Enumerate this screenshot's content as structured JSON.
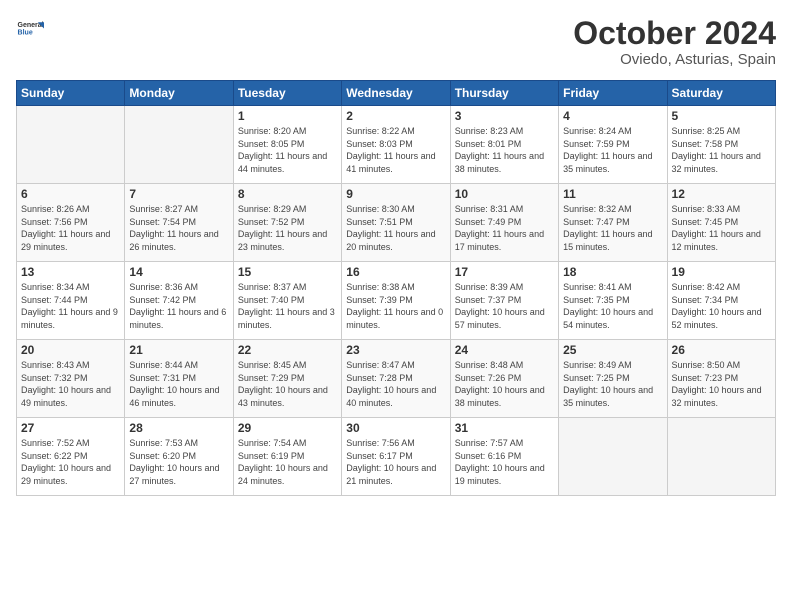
{
  "header": {
    "logo_line1": "General",
    "logo_line2": "Blue",
    "month_title": "October 2024",
    "location": "Oviedo, Asturias, Spain"
  },
  "weekdays": [
    "Sunday",
    "Monday",
    "Tuesday",
    "Wednesday",
    "Thursday",
    "Friday",
    "Saturday"
  ],
  "weeks": [
    [
      {
        "day": "",
        "empty": true
      },
      {
        "day": "",
        "empty": true
      },
      {
        "day": "1",
        "sunrise": "8:20 AM",
        "sunset": "8:05 PM",
        "daylight": "11 hours and 44 minutes."
      },
      {
        "day": "2",
        "sunrise": "8:22 AM",
        "sunset": "8:03 PM",
        "daylight": "11 hours and 41 minutes."
      },
      {
        "day": "3",
        "sunrise": "8:23 AM",
        "sunset": "8:01 PM",
        "daylight": "11 hours and 38 minutes."
      },
      {
        "day": "4",
        "sunrise": "8:24 AM",
        "sunset": "7:59 PM",
        "daylight": "11 hours and 35 minutes."
      },
      {
        "day": "5",
        "sunrise": "8:25 AM",
        "sunset": "7:58 PM",
        "daylight": "11 hours and 32 minutes."
      }
    ],
    [
      {
        "day": "6",
        "sunrise": "8:26 AM",
        "sunset": "7:56 PM",
        "daylight": "11 hours and 29 minutes."
      },
      {
        "day": "7",
        "sunrise": "8:27 AM",
        "sunset": "7:54 PM",
        "daylight": "11 hours and 26 minutes."
      },
      {
        "day": "8",
        "sunrise": "8:29 AM",
        "sunset": "7:52 PM",
        "daylight": "11 hours and 23 minutes."
      },
      {
        "day": "9",
        "sunrise": "8:30 AM",
        "sunset": "7:51 PM",
        "daylight": "11 hours and 20 minutes."
      },
      {
        "day": "10",
        "sunrise": "8:31 AM",
        "sunset": "7:49 PM",
        "daylight": "11 hours and 17 minutes."
      },
      {
        "day": "11",
        "sunrise": "8:32 AM",
        "sunset": "7:47 PM",
        "daylight": "11 hours and 15 minutes."
      },
      {
        "day": "12",
        "sunrise": "8:33 AM",
        "sunset": "7:45 PM",
        "daylight": "11 hours and 12 minutes."
      }
    ],
    [
      {
        "day": "13",
        "sunrise": "8:34 AM",
        "sunset": "7:44 PM",
        "daylight": "11 hours and 9 minutes."
      },
      {
        "day": "14",
        "sunrise": "8:36 AM",
        "sunset": "7:42 PM",
        "daylight": "11 hours and 6 minutes."
      },
      {
        "day": "15",
        "sunrise": "8:37 AM",
        "sunset": "7:40 PM",
        "daylight": "11 hours and 3 minutes."
      },
      {
        "day": "16",
        "sunrise": "8:38 AM",
        "sunset": "7:39 PM",
        "daylight": "11 hours and 0 minutes."
      },
      {
        "day": "17",
        "sunrise": "8:39 AM",
        "sunset": "7:37 PM",
        "daylight": "10 hours and 57 minutes."
      },
      {
        "day": "18",
        "sunrise": "8:41 AM",
        "sunset": "7:35 PM",
        "daylight": "10 hours and 54 minutes."
      },
      {
        "day": "19",
        "sunrise": "8:42 AM",
        "sunset": "7:34 PM",
        "daylight": "10 hours and 52 minutes."
      }
    ],
    [
      {
        "day": "20",
        "sunrise": "8:43 AM",
        "sunset": "7:32 PM",
        "daylight": "10 hours and 49 minutes."
      },
      {
        "day": "21",
        "sunrise": "8:44 AM",
        "sunset": "7:31 PM",
        "daylight": "10 hours and 46 minutes."
      },
      {
        "day": "22",
        "sunrise": "8:45 AM",
        "sunset": "7:29 PM",
        "daylight": "10 hours and 43 minutes."
      },
      {
        "day": "23",
        "sunrise": "8:47 AM",
        "sunset": "7:28 PM",
        "daylight": "10 hours and 40 minutes."
      },
      {
        "day": "24",
        "sunrise": "8:48 AM",
        "sunset": "7:26 PM",
        "daylight": "10 hours and 38 minutes."
      },
      {
        "day": "25",
        "sunrise": "8:49 AM",
        "sunset": "7:25 PM",
        "daylight": "10 hours and 35 minutes."
      },
      {
        "day": "26",
        "sunrise": "8:50 AM",
        "sunset": "7:23 PM",
        "daylight": "10 hours and 32 minutes."
      }
    ],
    [
      {
        "day": "27",
        "sunrise": "7:52 AM",
        "sunset": "6:22 PM",
        "daylight": "10 hours and 29 minutes."
      },
      {
        "day": "28",
        "sunrise": "7:53 AM",
        "sunset": "6:20 PM",
        "daylight": "10 hours and 27 minutes."
      },
      {
        "day": "29",
        "sunrise": "7:54 AM",
        "sunset": "6:19 PM",
        "daylight": "10 hours and 24 minutes."
      },
      {
        "day": "30",
        "sunrise": "7:56 AM",
        "sunset": "6:17 PM",
        "daylight": "10 hours and 21 minutes."
      },
      {
        "day": "31",
        "sunrise": "7:57 AM",
        "sunset": "6:16 PM",
        "daylight": "10 hours and 19 minutes."
      },
      {
        "day": "",
        "empty": true
      },
      {
        "day": "",
        "empty": true
      }
    ]
  ]
}
